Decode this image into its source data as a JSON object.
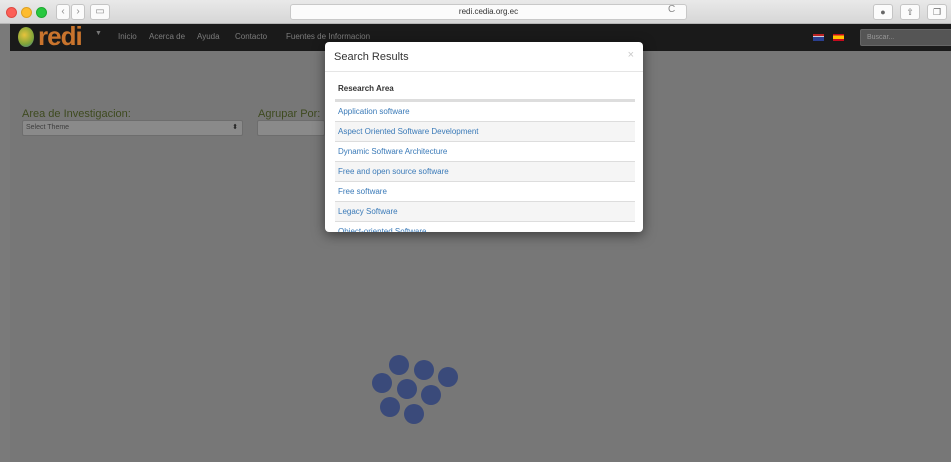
{
  "browser": {
    "url": "redi.cedia.org.ec",
    "back": "‹",
    "forward": "›",
    "reload": "C"
  },
  "header": {
    "logo": "redi",
    "nav": [
      "Inicio",
      "Acerca de",
      "Ayuda",
      "Contacto",
      "Fuentes de Informacion"
    ],
    "search_placeholder": "Buscar..."
  },
  "filters": {
    "area_label": "Area de Investigacion:",
    "area_value": "Select Theme",
    "group_label": "Agrupar Por:"
  },
  "modal": {
    "title": "Search Results",
    "close": "×",
    "column": "Research Area",
    "rows": [
      "Application software",
      "Aspect Oriented Software Development",
      "Dynamic Software Architecture",
      "Free and open source software",
      "Free software",
      "Legacy Software",
      "Object-oriented Software"
    ]
  }
}
